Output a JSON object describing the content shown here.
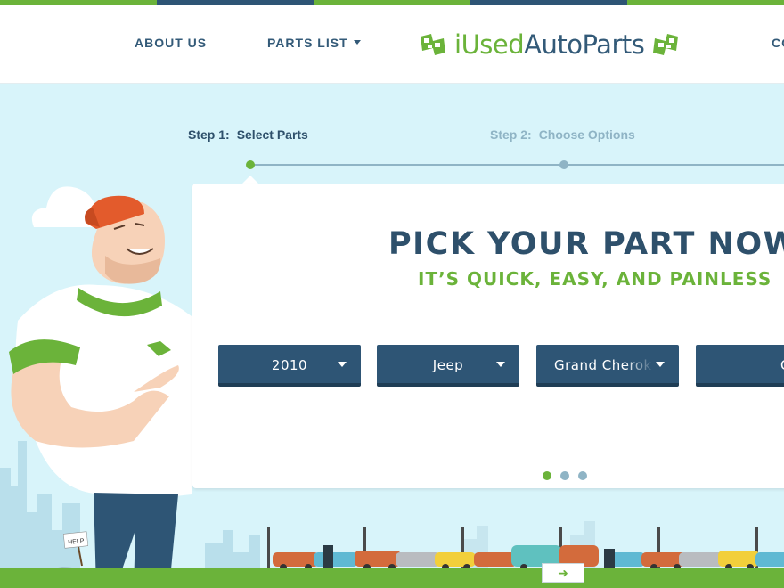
{
  "header": {
    "nav": {
      "about": "ABOUT US",
      "parts": "PARTS LIST",
      "contact": "CO"
    },
    "logo": {
      "i": "i",
      "used": "Used",
      "auto_parts": "AutoParts"
    }
  },
  "steps": {
    "step1": {
      "num": "Step 1:",
      "label": "Select Parts"
    },
    "step2": {
      "num": "Step 2:",
      "label": "Choose Options"
    }
  },
  "card": {
    "headline": "PICK YOUR PART NOW!",
    "subhead": "IT’S QUICK, EASY, AND PAINLESS",
    "selects": {
      "year": "2010",
      "make": "Jeep",
      "model": "Grand Cherokee",
      "partial": "C"
    },
    "pager": {
      "count": 3,
      "active": 1
    }
  },
  "scene": {
    "help_sign": "HELP",
    "arrow": "➜"
  },
  "colors": {
    "strip": [
      "#6bb33a",
      "#2e5575",
      "#6bb33a",
      "#2e5575",
      "#6bb33a"
    ],
    "green": "#6bb33a",
    "navy": "#2e5575",
    "sky": "#d8f4fa"
  }
}
